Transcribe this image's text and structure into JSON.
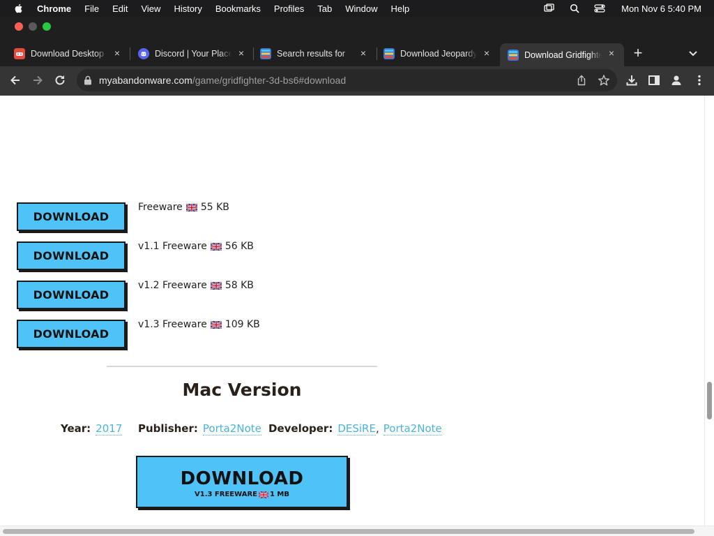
{
  "menubar": {
    "app": "Chrome",
    "items": [
      "File",
      "Edit",
      "View",
      "History",
      "Bookmarks",
      "Profiles",
      "Tab",
      "Window",
      "Help"
    ],
    "clock": "Mon Nov 6  5:40 PM"
  },
  "tabs": [
    {
      "title": "Download Desktop",
      "favicon_color": "#e64a3c",
      "icon": "controller-icon"
    },
    {
      "title": "Discord | Your Place",
      "favicon_color": "#5865f2",
      "icon": "discord-icon"
    },
    {
      "title": "Search results for",
      "favicon_color": "#7c4dff",
      "icon": "abandonware-icon"
    },
    {
      "title": "Download Jeopardy",
      "favicon_color": "#7c4dff",
      "icon": "abandonware-icon"
    },
    {
      "title": "Download Gridfighter",
      "favicon_color": "#7c4dff",
      "icon": "abandonware-icon",
      "active": true
    }
  ],
  "address_bar": {
    "host": "myabandonware.com",
    "path": "/game/gridfighter-3d-bs6#download"
  },
  "downloads": [
    {
      "label": "DOWNLOAD",
      "version": "",
      "license": "Freeware",
      "size": "55 KB"
    },
    {
      "label": "DOWNLOAD",
      "version": "v1.1",
      "license": "Freeware",
      "size": "56 KB"
    },
    {
      "label": "DOWNLOAD",
      "version": "v1.2",
      "license": "Freeware",
      "size": "58 KB"
    },
    {
      "label": "DOWNLOAD",
      "version": "v1.3",
      "license": "Freeware",
      "size": "109 KB"
    }
  ],
  "mac": {
    "title": "Mac Version",
    "year_label": "Year:",
    "year": "2017",
    "publisher_label": "Publisher:",
    "publisher": "Porta2Note",
    "developer_label": "Developer:",
    "developers": [
      "DESiRE",
      "Porta2Note"
    ],
    "button_label": "DOWNLOAD",
    "button_sub_left": "V1.3 FREEWARE",
    "button_sub_right": "1 MB"
  },
  "colors": {
    "button_blue": "#4fc3f7",
    "link_blue": "#4ab4dc",
    "heading": "#2a2218"
  }
}
